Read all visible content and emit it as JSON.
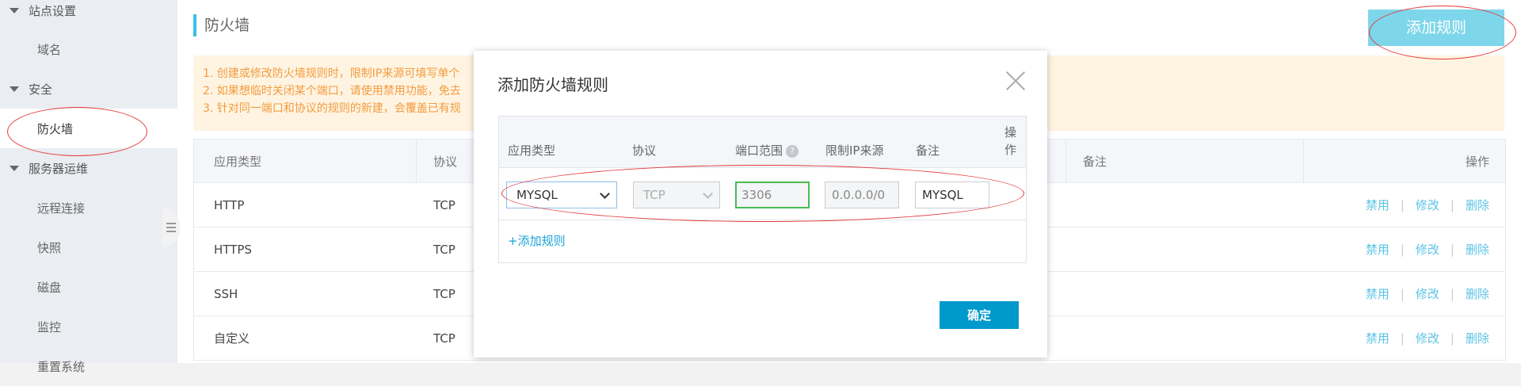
{
  "sidebar": {
    "groups": [
      {
        "label": "站点设置"
      },
      {
        "label": "安全"
      },
      {
        "label": "服务器运维"
      }
    ],
    "items": [
      {
        "label": "域名"
      },
      {
        "label": "防火墙"
      },
      {
        "label": "远程连接"
      },
      {
        "label": "快照"
      },
      {
        "label": "磁盘"
      },
      {
        "label": "监控"
      },
      {
        "label": "重置系统"
      }
    ]
  },
  "page": {
    "title": "防火墙",
    "add_button": "添加规则"
  },
  "notice": {
    "lines": [
      "1. 创建或修改防火墙规则时，限制IP来源可填写单个",
      "2. 如果想临时关闭某个端口，请使用禁用功能，免去",
      "3. 针对同一端口和协议的规则的新建，会覆盖已有规"
    ]
  },
  "table": {
    "headers": {
      "app_type": "应用类型",
      "protocol": "协议",
      "note": "备注",
      "ops": "操作"
    },
    "rows": [
      {
        "app_type": "HTTP",
        "protocol": "TCP"
      },
      {
        "app_type": "HTTPS",
        "protocol": "TCP"
      },
      {
        "app_type": "SSH",
        "protocol": "TCP"
      },
      {
        "app_type": "自定义",
        "protocol": "TCP"
      }
    ],
    "actions": {
      "disable": "禁用",
      "edit": "修改",
      "delete": "删除",
      "separator": "|"
    }
  },
  "modal": {
    "title": "添加防火墙规则",
    "headers": {
      "app_type": "应用类型",
      "protocol": "协议",
      "port_range": "端口范围",
      "port_help": "?",
      "ip_source": "限制IP来源",
      "note": "备注",
      "ops": "操作"
    },
    "row": {
      "app_type": "MYSQL",
      "protocol": "TCP",
      "port": "3306",
      "ip": "0.0.0.0/0",
      "note": "MYSQL"
    },
    "add_rule_link": "+添加规则",
    "confirm_button": "确定"
  },
  "colors": {
    "accent": "#39c0e8",
    "button_light": "#7ed6ea",
    "confirm": "#0099cc",
    "link": "#5bc4e6",
    "notice_text": "#f39b3f",
    "notice_bg": "#fff4e2",
    "annotation": "#e23a3a"
  }
}
